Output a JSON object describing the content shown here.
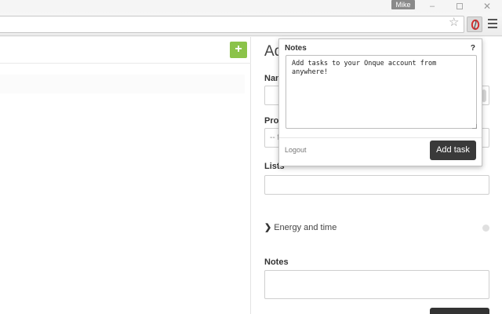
{
  "titlebar": {
    "user_name": "Mike",
    "minimize_glyph": "–",
    "close_glyph": "✕"
  },
  "toolbar": {
    "star_icon": "star-icon",
    "extension_icon": "onque-extension-icon",
    "menu_icon": "hamburger-menu-icon"
  },
  "left_pane": {
    "add_button_label": "+"
  },
  "form": {
    "title_partial": "Ad",
    "name_label_partial": "Nan",
    "project_label_partial": "Proj",
    "project_select_partial": "-- f",
    "lists_label": "Lists",
    "energy_label": "Energy and time",
    "notes_label": "Notes"
  },
  "popup": {
    "title": "Notes",
    "help": "?",
    "textarea_value": "Add tasks to your Onque account from\nanywhere!",
    "logout_label": "Logout",
    "add_task_label": "Add task"
  },
  "colors": {
    "accent_green": "#8bc34a",
    "button_dark": "#3a3a3a",
    "extension_red": "#d32f2f"
  }
}
